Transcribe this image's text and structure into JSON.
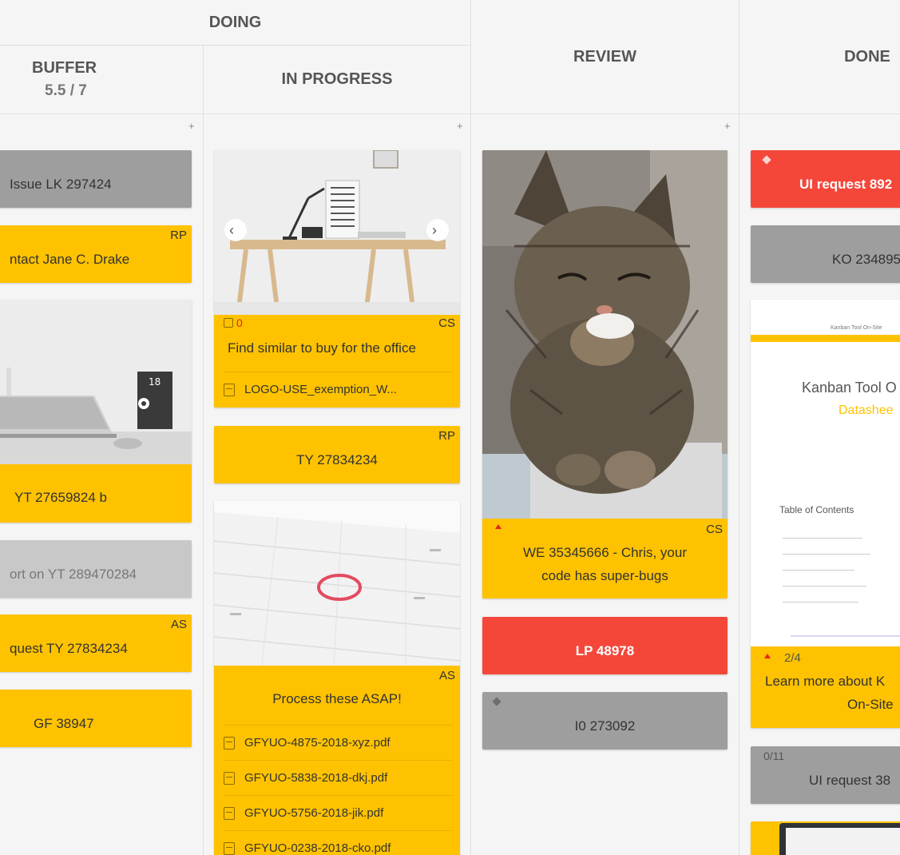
{
  "headers": {
    "doing": "DOING",
    "buffer_title": "BUFFER",
    "buffer_limit": "5.5 / 7",
    "in_progress": "IN PROGRESS",
    "review": "REVIEW",
    "done": "DONE"
  },
  "add_label": "+",
  "buffer": {
    "c1": "Issue LK 297424",
    "c2_tag": "RP",
    "c2": "ntact Jane C. Drake",
    "c3": "YT 27659824 b",
    "c3_calendar_num": "18",
    "c4": "ort on YT 289470284",
    "c5_tag": "AS",
    "c5": "quest TY 27834234",
    "c6": "GF 38947"
  },
  "in_progress": {
    "c1_due": "0",
    "c1_tag": "CS",
    "c1": "Find similar to buy for the office",
    "c1_file": "LOGO-USE_exemption_W...",
    "c2_tag": "RP",
    "c2": "TY 27834234",
    "c3_tag": "AS",
    "c3": "Process these ASAP!",
    "files": [
      "GFYUO-4875-2018-xyz.pdf",
      "GFYUO-5838-2018-dkj.pdf",
      "GFYUO-5756-2018-jik.pdf",
      "GFYUO-0238-2018-cko.pdf"
    ]
  },
  "review": {
    "c1_tag": "CS",
    "c1_line1": "WE 35345666 - Chris, your",
    "c1_line2": "code has super-bugs",
    "c2": "LP 48978",
    "c3": "I0 273092"
  },
  "done": {
    "c1": "UI request 892",
    "c2": "KO 234895",
    "doc_header": "Kanban Tool On-Site",
    "doc_title": "Kanban Tool O",
    "doc_subtitle": "Datashee",
    "doc_toc": "Table of Contents",
    "c3_progress": "2/4",
    "c3_line1": "Learn more about K",
    "c3_line2": "On-Site",
    "c4_progress": "0/11",
    "c4": "UI request 38"
  },
  "colors": {
    "yellow": "#fec200",
    "gray": "#9e9e9e",
    "red": "#f4473a",
    "light_gray": "#c8c8c8"
  }
}
